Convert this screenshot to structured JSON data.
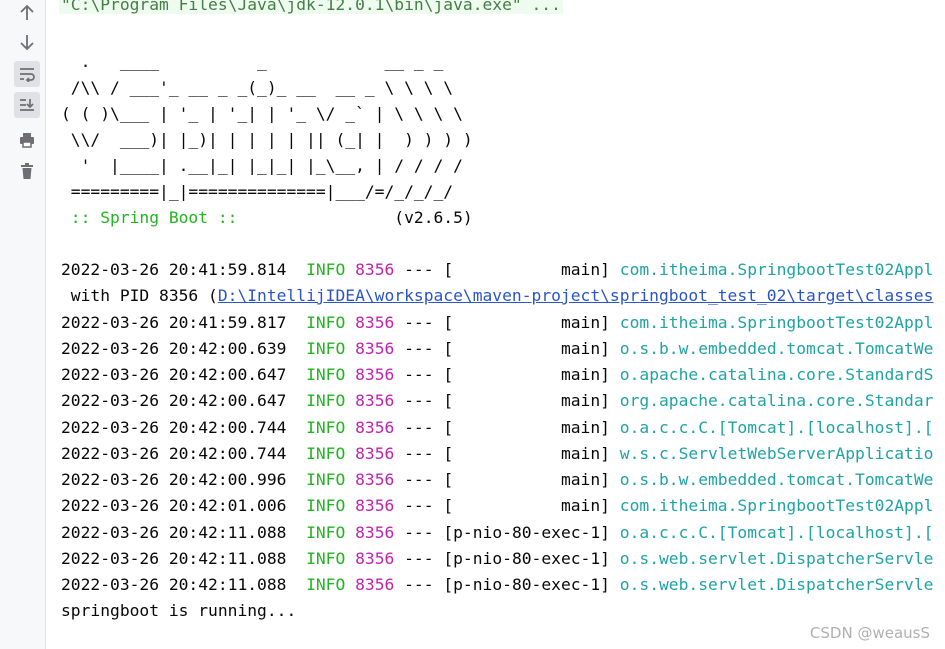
{
  "toolbar": {
    "buttons": [
      {
        "name": "up-arrow-icon"
      },
      {
        "name": "down-arrow-icon"
      },
      {
        "name": "soft-wrap-icon"
      },
      {
        "name": "scroll-to-end-icon"
      },
      {
        "name": "print-icon"
      },
      {
        "name": "trash-icon"
      }
    ]
  },
  "console": {
    "command": "\"C:\\Program Files\\Java\\jdk-12.0.1\\bin\\java.exe\" ...",
    "banner": [
      "  .   ____          _            __ _ _",
      " /\\\\ / ___'_ __ _ _(_)_ __  __ _ \\ \\ \\ \\",
      "( ( )\\___ | '_ | '_| | '_ \\/ _` | \\ \\ \\ \\",
      " \\\\/  ___)| |_)| | | | | || (_| |  ) ) ) )",
      "  '  |____| .__|_| |_|_| |_\\__, | / / / /",
      " =========|_|==============|___/=/_/_/_/"
    ],
    "spring_boot_label": " :: Spring Boot :: ",
    "spring_boot_version": "               (v2.6.5)",
    "log_lines": [
      {
        "ts": "2022-03-26 20:41:59.814",
        "level": "INFO",
        "pid": "8356",
        "sep": " --- ",
        "thread": "[           main]",
        "logger": "com.itheima.SpringbootTest02Appl"
      },
      {
        "ts": "2022-03-26 20:41:59.817",
        "level": "INFO",
        "pid": "8356",
        "sep": " --- ",
        "thread": "[           main]",
        "logger": "com.itheima.SpringbootTest02Appl"
      },
      {
        "ts": "2022-03-26 20:42:00.639",
        "level": "INFO",
        "pid": "8356",
        "sep": " --- ",
        "thread": "[           main]",
        "logger": "o.s.b.w.embedded.tomcat.TomcatWe"
      },
      {
        "ts": "2022-03-26 20:42:00.647",
        "level": "INFO",
        "pid": "8356",
        "sep": " --- ",
        "thread": "[           main]",
        "logger": "o.apache.catalina.core.StandardS"
      },
      {
        "ts": "2022-03-26 20:42:00.647",
        "level": "INFO",
        "pid": "8356",
        "sep": " --- ",
        "thread": "[           main]",
        "logger": "org.apache.catalina.core.Standar"
      },
      {
        "ts": "2022-03-26 20:42:00.744",
        "level": "INFO",
        "pid": "8356",
        "sep": " --- ",
        "thread": "[           main]",
        "logger": "o.a.c.c.C.[Tomcat].[localhost].["
      },
      {
        "ts": "2022-03-26 20:42:00.744",
        "level": "INFO",
        "pid": "8356",
        "sep": " --- ",
        "thread": "[           main]",
        "logger": "w.s.c.ServletWebServerApplicatio"
      },
      {
        "ts": "2022-03-26 20:42:00.996",
        "level": "INFO",
        "pid": "8356",
        "sep": " --- ",
        "thread": "[           main]",
        "logger": "o.s.b.w.embedded.tomcat.TomcatWe"
      },
      {
        "ts": "2022-03-26 20:42:01.006",
        "level": "INFO",
        "pid": "8356",
        "sep": " --- ",
        "thread": "[           main]",
        "logger": "com.itheima.SpringbootTest02Appl"
      },
      {
        "ts": "2022-03-26 20:42:11.088",
        "level": "INFO",
        "pid": "8356",
        "sep": " --- ",
        "thread": "[p-nio-80-exec-1]",
        "logger": "o.a.c.c.C.[Tomcat].[localhost].["
      },
      {
        "ts": "2022-03-26 20:42:11.088",
        "level": "INFO",
        "pid": "8356",
        "sep": " --- ",
        "thread": "[p-nio-80-exec-1]",
        "logger": "o.s.web.servlet.DispatcherServle"
      },
      {
        "ts": "2022-03-26 20:42:11.088",
        "level": "INFO",
        "pid": "8356",
        "sep": " --- ",
        "thread": "[p-nio-80-exec-1]",
        "logger": "o.s.web.servlet.DispatcherServle"
      }
    ],
    "pid_line_prefix": " with PID 8356 (",
    "pid_line_link": "D:\\IntellijIDEA\\workspace\\maven-project\\springboot_test_02\\target\\classes",
    "output_line": "springboot is running..."
  },
  "watermark": "CSDN @weausS"
}
